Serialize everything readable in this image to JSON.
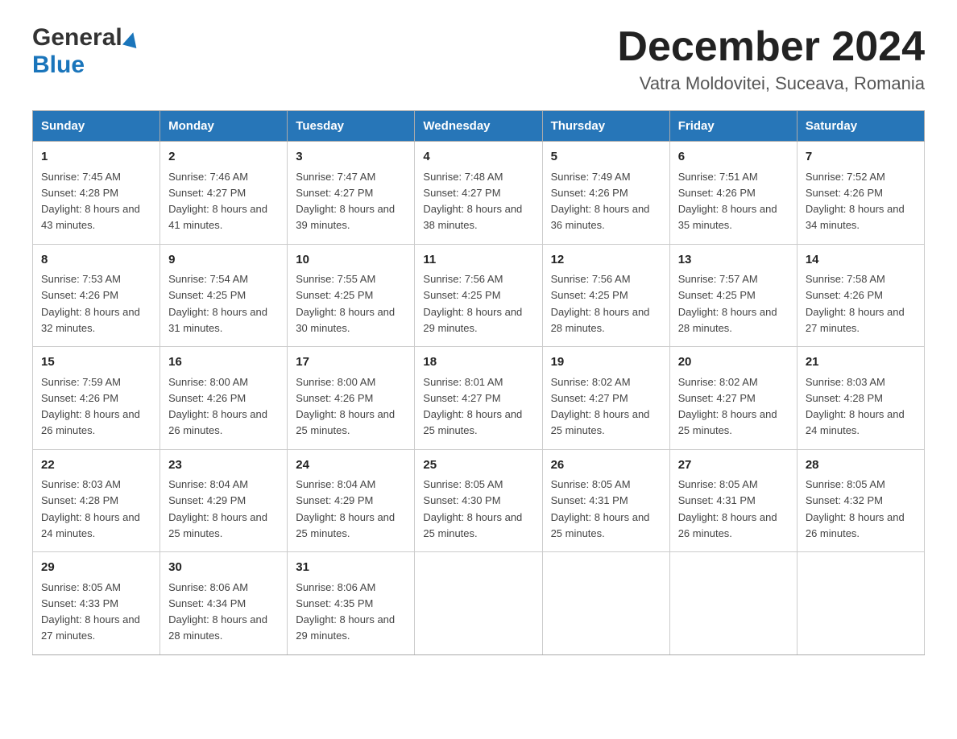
{
  "logo": {
    "general": "General",
    "blue": "Blue",
    "triangle": "▶"
  },
  "title": "December 2024",
  "subtitle": "Vatra Moldovitei, Suceava, Romania",
  "weekdays": [
    "Sunday",
    "Monday",
    "Tuesday",
    "Wednesday",
    "Thursday",
    "Friday",
    "Saturday"
  ],
  "weeks": [
    [
      {
        "day": "1",
        "sunrise": "7:45 AM",
        "sunset": "4:28 PM",
        "daylight": "8 hours and 43 minutes."
      },
      {
        "day": "2",
        "sunrise": "7:46 AM",
        "sunset": "4:27 PM",
        "daylight": "8 hours and 41 minutes."
      },
      {
        "day": "3",
        "sunrise": "7:47 AM",
        "sunset": "4:27 PM",
        "daylight": "8 hours and 39 minutes."
      },
      {
        "day": "4",
        "sunrise": "7:48 AM",
        "sunset": "4:27 PM",
        "daylight": "8 hours and 38 minutes."
      },
      {
        "day": "5",
        "sunrise": "7:49 AM",
        "sunset": "4:26 PM",
        "daylight": "8 hours and 36 minutes."
      },
      {
        "day": "6",
        "sunrise": "7:51 AM",
        "sunset": "4:26 PM",
        "daylight": "8 hours and 35 minutes."
      },
      {
        "day": "7",
        "sunrise": "7:52 AM",
        "sunset": "4:26 PM",
        "daylight": "8 hours and 34 minutes."
      }
    ],
    [
      {
        "day": "8",
        "sunrise": "7:53 AM",
        "sunset": "4:26 PM",
        "daylight": "8 hours and 32 minutes."
      },
      {
        "day": "9",
        "sunrise": "7:54 AM",
        "sunset": "4:25 PM",
        "daylight": "8 hours and 31 minutes."
      },
      {
        "day": "10",
        "sunrise": "7:55 AM",
        "sunset": "4:25 PM",
        "daylight": "8 hours and 30 minutes."
      },
      {
        "day": "11",
        "sunrise": "7:56 AM",
        "sunset": "4:25 PM",
        "daylight": "8 hours and 29 minutes."
      },
      {
        "day": "12",
        "sunrise": "7:56 AM",
        "sunset": "4:25 PM",
        "daylight": "8 hours and 28 minutes."
      },
      {
        "day": "13",
        "sunrise": "7:57 AM",
        "sunset": "4:25 PM",
        "daylight": "8 hours and 28 minutes."
      },
      {
        "day": "14",
        "sunrise": "7:58 AM",
        "sunset": "4:26 PM",
        "daylight": "8 hours and 27 minutes."
      }
    ],
    [
      {
        "day": "15",
        "sunrise": "7:59 AM",
        "sunset": "4:26 PM",
        "daylight": "8 hours and 26 minutes."
      },
      {
        "day": "16",
        "sunrise": "8:00 AM",
        "sunset": "4:26 PM",
        "daylight": "8 hours and 26 minutes."
      },
      {
        "day": "17",
        "sunrise": "8:00 AM",
        "sunset": "4:26 PM",
        "daylight": "8 hours and 25 minutes."
      },
      {
        "day": "18",
        "sunrise": "8:01 AM",
        "sunset": "4:27 PM",
        "daylight": "8 hours and 25 minutes."
      },
      {
        "day": "19",
        "sunrise": "8:02 AM",
        "sunset": "4:27 PM",
        "daylight": "8 hours and 25 minutes."
      },
      {
        "day": "20",
        "sunrise": "8:02 AM",
        "sunset": "4:27 PM",
        "daylight": "8 hours and 25 minutes."
      },
      {
        "day": "21",
        "sunrise": "8:03 AM",
        "sunset": "4:28 PM",
        "daylight": "8 hours and 24 minutes."
      }
    ],
    [
      {
        "day": "22",
        "sunrise": "8:03 AM",
        "sunset": "4:28 PM",
        "daylight": "8 hours and 24 minutes."
      },
      {
        "day": "23",
        "sunrise": "8:04 AM",
        "sunset": "4:29 PM",
        "daylight": "8 hours and 25 minutes."
      },
      {
        "day": "24",
        "sunrise": "8:04 AM",
        "sunset": "4:29 PM",
        "daylight": "8 hours and 25 minutes."
      },
      {
        "day": "25",
        "sunrise": "8:05 AM",
        "sunset": "4:30 PM",
        "daylight": "8 hours and 25 minutes."
      },
      {
        "day": "26",
        "sunrise": "8:05 AM",
        "sunset": "4:31 PM",
        "daylight": "8 hours and 25 minutes."
      },
      {
        "day": "27",
        "sunrise": "8:05 AM",
        "sunset": "4:31 PM",
        "daylight": "8 hours and 26 minutes."
      },
      {
        "day": "28",
        "sunrise": "8:05 AM",
        "sunset": "4:32 PM",
        "daylight": "8 hours and 26 minutes."
      }
    ],
    [
      {
        "day": "29",
        "sunrise": "8:05 AM",
        "sunset": "4:33 PM",
        "daylight": "8 hours and 27 minutes."
      },
      {
        "day": "30",
        "sunrise": "8:06 AM",
        "sunset": "4:34 PM",
        "daylight": "8 hours and 28 minutes."
      },
      {
        "day": "31",
        "sunrise": "8:06 AM",
        "sunset": "4:35 PM",
        "daylight": "8 hours and 29 minutes."
      },
      null,
      null,
      null,
      null
    ]
  ]
}
